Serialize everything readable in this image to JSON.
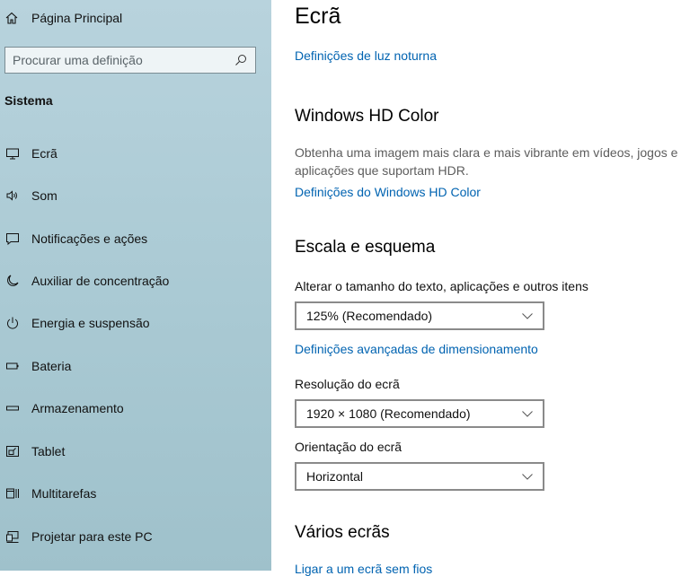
{
  "sidebar": {
    "home_label": "Página Principal",
    "search_placeholder": "Procurar uma definição",
    "section_title": "Sistema",
    "items": [
      {
        "label": "Ecrã",
        "icon": "monitor-icon"
      },
      {
        "label": "Som",
        "icon": "speaker-icon"
      },
      {
        "label": "Notificações e ações",
        "icon": "notification-icon"
      },
      {
        "label": "Auxiliar de concentração",
        "icon": "moon-icon"
      },
      {
        "label": "Energia e suspensão",
        "icon": "power-icon"
      },
      {
        "label": "Bateria",
        "icon": "battery-icon"
      },
      {
        "label": "Armazenamento",
        "icon": "storage-icon"
      },
      {
        "label": "Tablet",
        "icon": "tablet-icon"
      },
      {
        "label": "Multitarefas",
        "icon": "multitasking-icon"
      },
      {
        "label": "Projetar para este PC",
        "icon": "project-icon"
      }
    ]
  },
  "main": {
    "title": "Ecrã",
    "night_light_link": "Definições de luz noturna",
    "hd_color": {
      "heading": "Windows HD Color",
      "description": "Obtenha uma imagem mais clara e mais vibrante em vídeos, jogos e aplicações que suportam HDR.",
      "link": "Definições do Windows HD Color"
    },
    "scale": {
      "heading": "Escala e esquema",
      "size_label": "Alterar o tamanho do texto, aplicações e outros itens",
      "size_value": "125% (Recomendado)",
      "advanced_link": "Definições avançadas de dimensionamento",
      "resolution_label": "Resolução do ecrã",
      "resolution_value": "1920 × 1080 (Recomendado)",
      "orientation_label": "Orientação do ecrã",
      "orientation_value": "Horizontal"
    },
    "multiple": {
      "heading": "Vários ecrãs",
      "link": "Ligar a um ecrã sem fios"
    }
  },
  "colors": {
    "link": "#0063b1",
    "sidebar_bg": "#b8d3dd"
  }
}
